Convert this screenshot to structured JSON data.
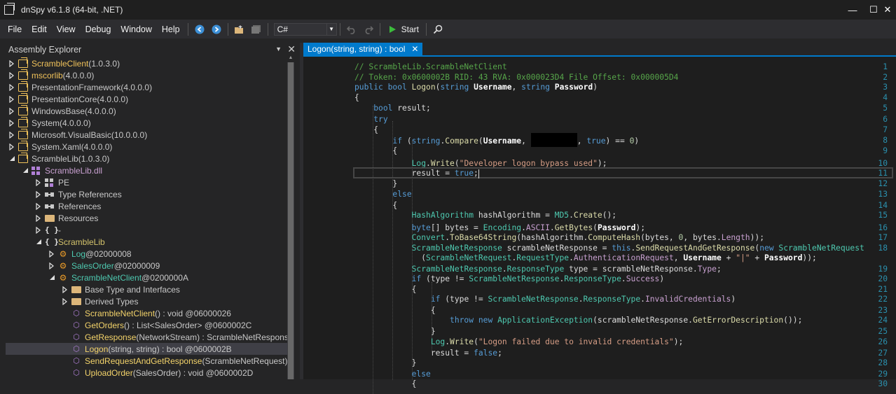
{
  "window": {
    "title": "dnSpy v6.1.8 (64-bit, .NET)",
    "minimize": "—",
    "maximize": "☐",
    "close": "✕"
  },
  "menu": [
    "File",
    "Edit",
    "View",
    "Debug",
    "Window",
    "Help"
  ],
  "toolbar": {
    "language": "C#",
    "start_label": "Start"
  },
  "assembly_explorer": {
    "title": "Assembly Explorer",
    "items": [
      {
        "indent": 0,
        "tw": "collapsed",
        "icon": "asm",
        "name": "ScrambleClient",
        "extra": " (1.0.3.0)",
        "cls": "lk"
      },
      {
        "indent": 0,
        "tw": "collapsed",
        "icon": "asm",
        "name": "mscorlib",
        "extra": " (4.0.0.0)",
        "cls": "lk"
      },
      {
        "indent": 0,
        "tw": "collapsed",
        "icon": "asm",
        "name": "PresentationFramework",
        "extra": " (4.0.0.0)",
        "cls": "gray"
      },
      {
        "indent": 0,
        "tw": "collapsed",
        "icon": "asm",
        "name": "PresentationCore",
        "extra": " (4.0.0.0)",
        "cls": "gray"
      },
      {
        "indent": 0,
        "tw": "collapsed",
        "icon": "asm",
        "name": "WindowsBase",
        "extra": " (4.0.0.0)",
        "cls": "gray"
      },
      {
        "indent": 0,
        "tw": "collapsed",
        "icon": "asm",
        "name": "System",
        "extra": " (4.0.0.0)",
        "cls": "gray"
      },
      {
        "indent": 0,
        "tw": "collapsed",
        "icon": "asm",
        "name": "Microsoft.VisualBasic",
        "extra": " (10.0.0.0)",
        "cls": "gray"
      },
      {
        "indent": 0,
        "tw": "collapsed",
        "icon": "asm",
        "name": "System.Xaml",
        "extra": " (4.0.0.0)",
        "cls": "gray"
      },
      {
        "indent": 0,
        "tw": "expanded",
        "icon": "asm",
        "name": "ScrambleLib",
        "extra": " (1.0.3.0)",
        "cls": "gray"
      },
      {
        "indent": 1,
        "tw": "expanded",
        "icon": "dll",
        "name": "ScrambleLib.dll",
        "extra": "",
        "cls": "pr"
      },
      {
        "indent": 2,
        "tw": "collapsed",
        "icon": "pe",
        "name": "PE",
        "extra": "",
        "cls": "gray"
      },
      {
        "indent": 2,
        "tw": "collapsed",
        "icon": "ref",
        "name": "Type References",
        "extra": "",
        "cls": "gray"
      },
      {
        "indent": 2,
        "tw": "collapsed",
        "icon": "ref",
        "name": "References",
        "extra": "",
        "cls": "gray"
      },
      {
        "indent": 2,
        "tw": "collapsed",
        "icon": "fold",
        "name": "Resources",
        "extra": "",
        "cls": "gray"
      },
      {
        "indent": 2,
        "tw": "collapsed",
        "icon": "ns",
        "name": "-",
        "extra": "",
        "cls": "gray"
      },
      {
        "indent": 2,
        "tw": "expanded",
        "icon": "ns",
        "name": "ScrambleLib",
        "extra": "",
        "cls": "lkn"
      },
      {
        "indent": 3,
        "tw": "collapsed",
        "icon": "cls",
        "name": "Log",
        "extra": " @02000008",
        "cls": "lkt"
      },
      {
        "indent": 3,
        "tw": "collapsed",
        "icon": "cls",
        "name": "SalesOrder",
        "extra": " @02000009",
        "cls": "lkt"
      },
      {
        "indent": 3,
        "tw": "expanded",
        "icon": "cls",
        "name": "ScrambleNetClient",
        "extra": " @0200000A",
        "cls": "lkt"
      },
      {
        "indent": 4,
        "tw": "collapsed",
        "icon": "fold",
        "name": "Base Type and Interfaces",
        "extra": "",
        "cls": "gray"
      },
      {
        "indent": 4,
        "tw": "collapsed",
        "icon": "fold",
        "name": "Derived Types",
        "extra": "",
        "cls": "gray"
      },
      {
        "indent": 4,
        "tw": "none",
        "icon": "mth",
        "name": "ScrambleNetClient",
        "extra": "() : void @06000026",
        "cls": "lkm"
      },
      {
        "indent": 4,
        "tw": "none",
        "icon": "mth",
        "name": "GetOrders",
        "extra": "() : List<SalesOrder> @0600002C",
        "cls": "lkm"
      },
      {
        "indent": 4,
        "tw": "none",
        "icon": "mth",
        "name": "GetResponse",
        "extra": "(NetworkStream) : ScrambleNetResponse",
        "cls": "lkm"
      },
      {
        "indent": 4,
        "tw": "none",
        "icon": "mth",
        "name": "Logon",
        "extra": "(string, string) : bool @0600002B",
        "cls": "lkm",
        "selected": true
      },
      {
        "indent": 4,
        "tw": "none",
        "icon": "mth",
        "name": "SendRequestAndGetResponse",
        "extra": "(ScrambleNetRequest) : S",
        "cls": "lkm"
      },
      {
        "indent": 4,
        "tw": "none",
        "icon": "mth",
        "name": "UploadOrder",
        "extra": "(SalesOrder) : void @0600002D",
        "cls": "lkm"
      }
    ]
  },
  "editor": {
    "tab_title": "Logon(string, string) : bool",
    "lines": [
      {
        "n": "1",
        "html": "<span class=\"cm\">// ScrambleLib.ScrambleNetClient</span>"
      },
      {
        "n": "2",
        "html": "<span class=\"cm\">// Token: 0x0600002B RID: 43 RVA: 0x000023D4 File Offset: 0x000005D4</span>"
      },
      {
        "n": "3",
        "html": "<span class=\"kw\">public</span> <span class=\"kw\">bool</span> <span class=\"mt\">Logon</span>(<span class=\"kw\">string</span> <span class=\"pa\">Username</span>, <span class=\"kw\">string</span> <span class=\"pa\">Password</span>)"
      },
      {
        "n": "4",
        "html": "{"
      },
      {
        "n": "5",
        "html": "    <span class=\"kw\">bool</span> result;"
      },
      {
        "n": "6",
        "html": "    <span class=\"kw\">try</span>"
      },
      {
        "n": "7",
        "html": "    {"
      },
      {
        "n": "8",
        "html": "        <span class=\"kw\">if</span> (<span class=\"kw\">string</span>.<span class=\"mt\">Compare</span>(<span class=\"pa\">Username</span>, <span class=\"redact\"></span>, <span class=\"kw\">true</span>) == <span class=\"nu\">0</span>)"
      },
      {
        "n": "9",
        "html": "        {"
      },
      {
        "n": "10",
        "html": "            <span class=\"ty\">Log</span>.<span class=\"mt\">Write</span>(<span class=\"st\">\"Developer logon bypass used\"</span>);"
      },
      {
        "n": "11",
        "html": "            result = <span class=\"kw\">true</span>;<span class=\"caret\"></span>"
      },
      {
        "n": "12",
        "html": "        }"
      },
      {
        "n": "13",
        "html": "        <span class=\"kw\">else</span>"
      },
      {
        "n": "14",
        "html": "        {"
      },
      {
        "n": "15",
        "html": "            <span class=\"ty\">HashAlgorithm</span> hashAlgorithm = <span class=\"ty\">MD5</span>.<span class=\"mt\">Create</span>();"
      },
      {
        "n": "16",
        "html": "            <span class=\"kw\">byte</span>[] bytes = <span class=\"ty\">Encoding</span>.<span class=\"pr\">ASCII</span>.<span class=\"mt\">GetBytes</span>(<span class=\"pa\">Password</span>);"
      },
      {
        "n": "17",
        "html": "            <span class=\"ty\">Convert</span>.<span class=\"mt\">ToBase64String</span>(hashAlgorithm.<span class=\"mt\">ComputeHash</span>(bytes, <span class=\"nu\">0</span>, bytes.<span class=\"pr\">Length</span>));"
      },
      {
        "n": "18",
        "html": "            <span class=\"ty\">ScrambleNetResponse</span> scrambleNetResponse = <span class=\"kw\">this</span>.<span class=\"mt\">SendRequestAndGetResponse</span>(<span class=\"kw\">new</span> <span class=\"ty\">ScrambleNetRequest</span>"
      },
      {
        "n": "",
        "html": "              (<span class=\"ty\">ScrambleNetRequest</span>.<span class=\"ty\">RequestType</span>.<span class=\"pr\">AuthenticationRequest</span>, <span class=\"pa\">Username</span> + <span class=\"st\">\"|\"</span> + <span class=\"pa\">Password</span>));"
      },
      {
        "n": "19",
        "html": "            <span class=\"ty\">ScrambleNetResponse</span>.<span class=\"ty\">ResponseType</span> type = scrambleNetResponse.<span class=\"pr\">Type</span>;"
      },
      {
        "n": "20",
        "html": "            <span class=\"kw\">if</span> (type != <span class=\"ty\">ScrambleNetResponse</span>.<span class=\"ty\">ResponseType</span>.<span class=\"pr\">Success</span>)"
      },
      {
        "n": "21",
        "html": "            {"
      },
      {
        "n": "22",
        "html": "                <span class=\"kw\">if</span> (type != <span class=\"ty\">ScrambleNetResponse</span>.<span class=\"ty\">ResponseType</span>.<span class=\"pr\">InvalidCredentials</span>)"
      },
      {
        "n": "23",
        "html": "                {"
      },
      {
        "n": "24",
        "html": "                    <span class=\"kw\">throw</span> <span class=\"kw\">new</span> <span class=\"ty\">ApplicationException</span>(scrambleNetResponse.<span class=\"mt\">GetErrorDescription</span>());"
      },
      {
        "n": "25",
        "html": "                }"
      },
      {
        "n": "26",
        "html": "                <span class=\"ty\">Log</span>.<span class=\"mt\">Write</span>(<span class=\"st\">\"Logon failed due to invalid credentials\"</span>);"
      },
      {
        "n": "27",
        "html": "                result = <span class=\"kw\">false</span>;"
      },
      {
        "n": "28",
        "html": "            }"
      },
      {
        "n": "29",
        "html": "            <span class=\"kw\">else</span>"
      },
      {
        "n": "30",
        "html": "            {"
      }
    ]
  },
  "colors": {
    "accent": "#007acc",
    "background": "#1e1e1e",
    "panel": "#252526"
  }
}
